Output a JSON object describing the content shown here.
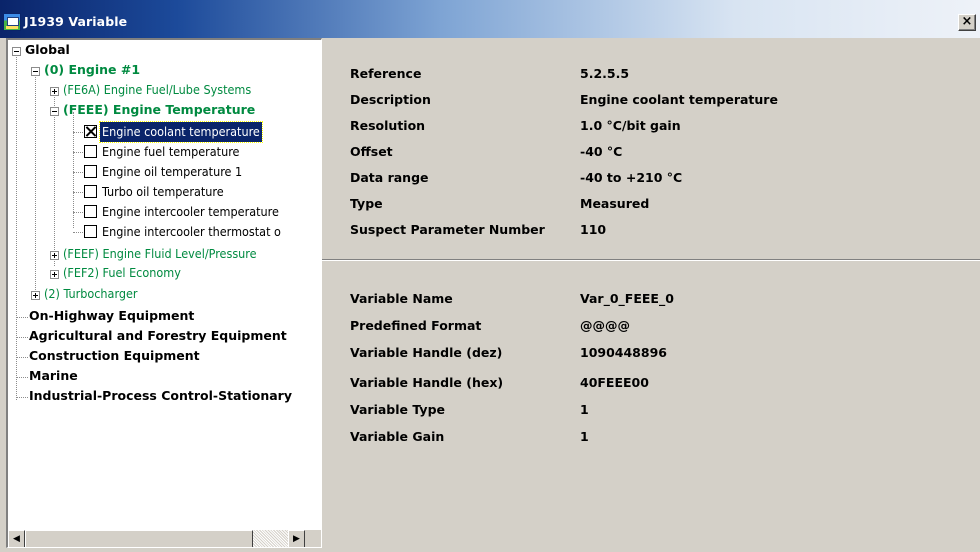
{
  "window": {
    "title": "J1939 Variable",
    "close_label": "×"
  },
  "tree": {
    "global": "Global",
    "engine": "(0)  Engine #1",
    "fe6a": "(FE6A)  Engine Fuel/Lube Systems",
    "feee": "(FEEE)  Engine Temperature",
    "params": [
      {
        "label": "Engine coolant temperature",
        "checked": true,
        "selected": true
      },
      {
        "label": "Engine fuel temperature",
        "checked": false
      },
      {
        "label": "Engine oil temperature 1",
        "checked": false
      },
      {
        "label": "Turbo oil temperature",
        "checked": false
      },
      {
        "label": "Engine intercooler temperature",
        "checked": false
      },
      {
        "label": "Engine intercooler thermostat o",
        "checked": false
      }
    ],
    "feef": "(FEEF)  Engine Fluid Level/Pressure",
    "fef2": "(FEF2)  Fuel Economy",
    "turbo": "(2)  Turbocharger",
    "top_level": [
      "On-Highway Equipment",
      "Agricultural and Forestry Equipment",
      "Construction Equipment",
      "Marine",
      "Industrial-Process Control-Stationary"
    ]
  },
  "details": {
    "parameter": [
      {
        "label": "Reference",
        "value": "5.2.5.5"
      },
      {
        "label": "Description",
        "value": "Engine coolant temperature"
      },
      {
        "label": "Resolution",
        "value": "1.0 °C/bit gain"
      },
      {
        "label": "Offset",
        "value": "-40 °C"
      },
      {
        "label": "Data range",
        "value": "-40 to +210 °C"
      },
      {
        "label": "Type",
        "value": "Measured"
      },
      {
        "label": "Suspect Parameter Number",
        "value": "110"
      }
    ],
    "variable": [
      {
        "label": "Variable Name",
        "value": "Var_0_FEEE_0"
      },
      {
        "label": "Predefined Format",
        "value": "@@@@"
      },
      {
        "label": "Variable Handle (dez)",
        "value": "1090448896"
      },
      {
        "label": "Variable Handle (hex)",
        "value": "40FEEE00"
      },
      {
        "label": "Variable Type",
        "value": "1"
      },
      {
        "label": "Variable Gain",
        "value": "1"
      }
    ]
  },
  "colors": {
    "title_start": "#0a246a",
    "green_text": "#008a40",
    "selection": "#0a246a",
    "face": "#d4d0c8"
  },
  "icons": {
    "app": "app-icon",
    "close": "close-icon",
    "scroll_left": "scroll-left-icon",
    "scroll_right": "scroll-right-icon"
  }
}
